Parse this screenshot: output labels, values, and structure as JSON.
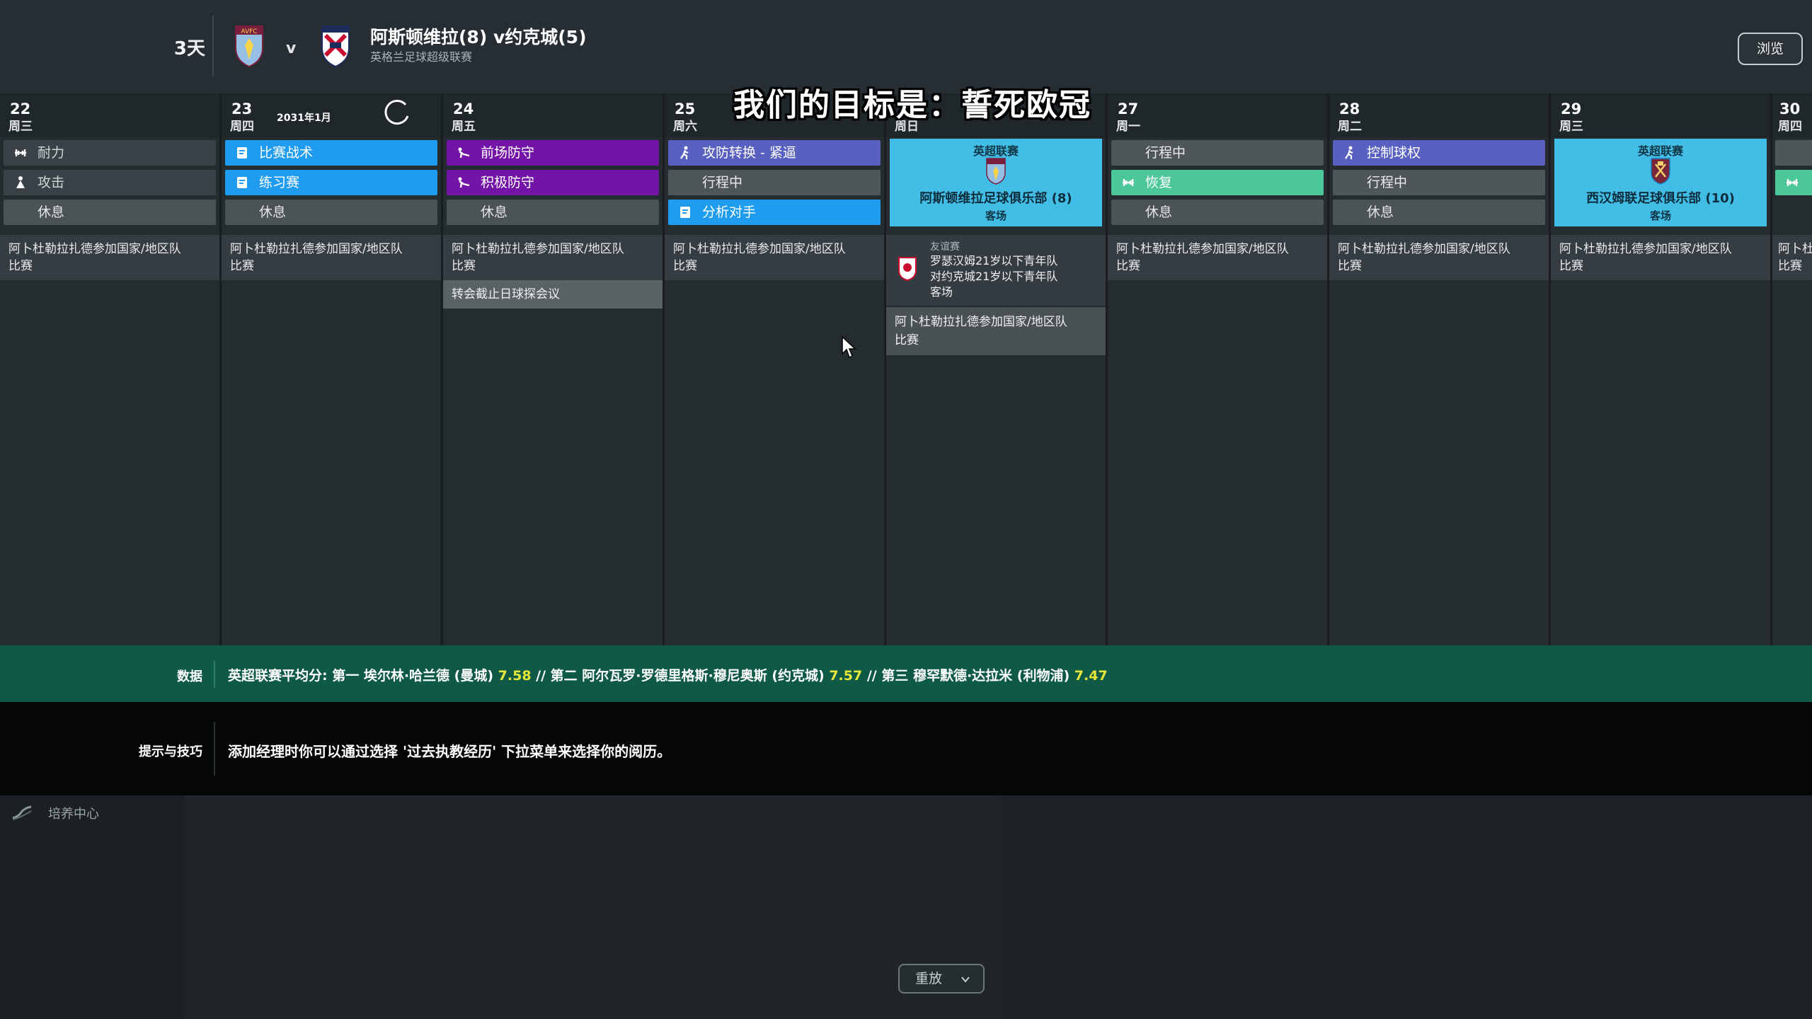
{
  "header": {
    "days_left": "3天",
    "vs": "v",
    "match_title": "阿斯顿维拉(8) v约克城(5)",
    "competition": "英格兰足球超级联赛",
    "browse_label": "浏览",
    "home_crest": "aston-villa-crest-icon",
    "away_crest": "york-city-crest-icon"
  },
  "caption": "我们的目标是：誓死欧冠",
  "calendar": {
    "month_label": "2031年1月",
    "days": [
      {
        "num": "22",
        "weekday": "周三"
      },
      {
        "num": "23",
        "weekday": "周四"
      },
      {
        "num": "24",
        "weekday": "周五"
      },
      {
        "num": "25",
        "weekday": "周六"
      },
      {
        "num": "26",
        "weekday": "周日"
      },
      {
        "num": "27",
        "weekday": "周一"
      },
      {
        "num": "28",
        "weekday": "周二"
      },
      {
        "num": "29",
        "weekday": "周三"
      },
      {
        "num": "30",
        "weekday": "周四"
      }
    ],
    "slots": {
      "d22": [
        "耐力",
        "攻击",
        "休息"
      ],
      "d23": [
        "比赛战术",
        "练习赛",
        "休息"
      ],
      "d24": [
        "前场防守",
        "积极防守",
        "休息"
      ],
      "d25": [
        "攻防转换 - 紧逼",
        "行程中",
        "分析对手"
      ],
      "d27": [
        "行程中",
        "恢复",
        "休息"
      ],
      "d28": [
        "控制球权",
        "行程中",
        "休息"
      ]
    },
    "match_26": {
      "competition": "英超联赛",
      "team": "阿斯顿维拉足球俱乐部 (8)",
      "venue": "客场"
    },
    "match_29": {
      "competition": "英超联赛",
      "team": "西汉姆联足球俱乐部 (10)",
      "venue": "客场"
    },
    "event_text": "阿卜杜勒拉扎德参加国家/地区队比赛",
    "event_line1": "阿卜杜勒拉扎德参加国家/地区队",
    "event_line2": "比赛",
    "event_short1": "阿卜杜",
    "event_short2": "比赛",
    "transfer_meeting": "转会截止日球探会议",
    "friendly": {
      "competition": "友谊赛",
      "line1": "罗瑟汉姆21岁以下青年队",
      "line2": "对约克城21岁以下青年队",
      "venue": "客场"
    }
  },
  "data_strip": {
    "label": "数据",
    "part1": "英超联赛平均分: 第一 埃尔林·哈兰德 (曼城)",
    "v1": "7.58",
    "part2": "// 第二 阿尔瓦罗·罗德里格斯·穆尼奥斯 (约克城)",
    "v2": "7.57",
    "part3": "// 第三 穆罕默德·达拉米 (利物浦)",
    "v3": "7.47"
  },
  "tips": {
    "label": "提示与技巧",
    "text": "添加经理时你可以通过选择 '过去执教经历' 下拉菜单来选择你的阅历。"
  },
  "lower": {
    "dev_label": "培养中心",
    "replay_label": "重放"
  },
  "colors": {
    "training_blue": "#1f9cf0",
    "defending_purple": "#7414a6",
    "tactics_indigo": "#5961c0",
    "recovery_teal": "#4cc79a",
    "match_cyan": "#42bde6",
    "data_green": "#0f5a46",
    "highlight_yellow": "#e6e53a"
  }
}
